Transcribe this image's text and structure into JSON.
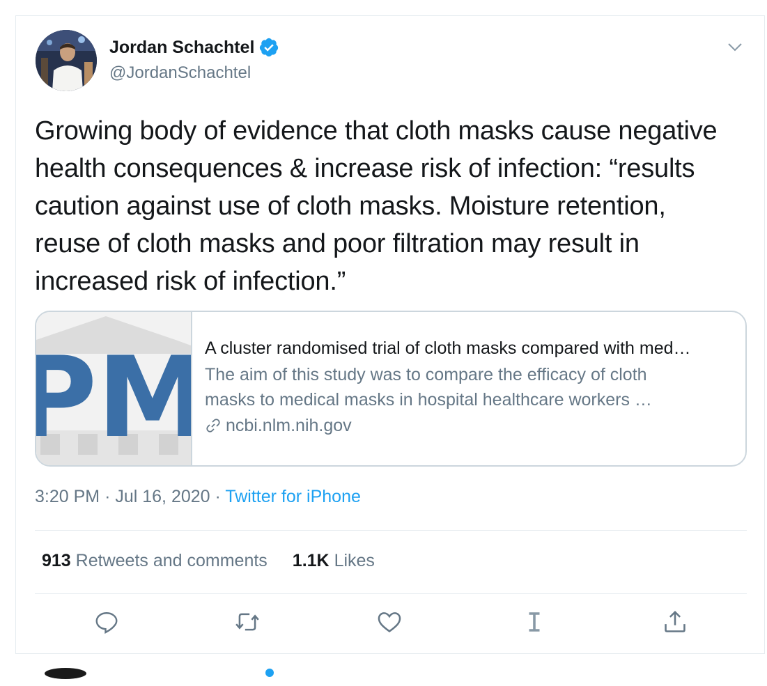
{
  "author": {
    "name": "Jordan Schachtel",
    "handle": "@JordanSchachtel",
    "verified": true,
    "avatar_icon": "avatar-photo"
  },
  "tweet": {
    "text": "Growing body of evidence that cloth masks cause negative health consequences & increase risk of infection: “results caution against use of cloth masks. Moisture retention, reuse of cloth masks and poor filtration may result in increased risk of infection.”",
    "time": "3:20 PM",
    "separator": "·",
    "date": "Jul 16, 2020",
    "source": "Twitter for iPhone"
  },
  "card": {
    "image_text": "PMC",
    "title": "A cluster randomised trial of cloth masks compared with med…",
    "description_line1": "The aim of this study was to compare the efficacy of cloth",
    "description_line2": "masks to medical masks in hospital healthcare workers …",
    "domain": "ncbi.nlm.nih.gov"
  },
  "stats": {
    "retweets_count": "913",
    "retweets_label": "Retweets and comments",
    "likes_count": "1.1K",
    "likes_label": "Likes"
  },
  "actions": [
    "reply-icon",
    "retweet-icon",
    "like-icon",
    "i-icon",
    "share-icon"
  ],
  "colors": {
    "accent": "#1da1f2",
    "text": "#14171a",
    "muted": "#657786",
    "border": "#ccd6dd",
    "pmc_blue": "#3b6fa7"
  }
}
